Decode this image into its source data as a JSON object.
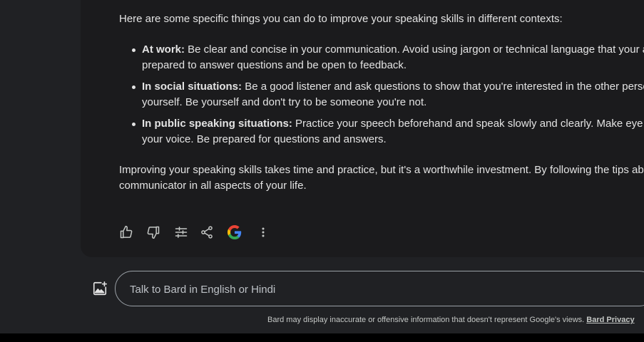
{
  "response": {
    "intro": "Here are some specific things you can do to improve your speaking skills in different contexts:",
    "bullets": [
      {
        "label": "At work:",
        "line1": " Be clear and concise in your communication. Avoid using jargon or technical language that your aud",
        "line2": "prepared to answer questions and be open to feedback."
      },
      {
        "label": "In social situations:",
        "line1": " Be a good listener and ask questions to show that you're interested in the other person.",
        "line2": "yourself. Be yourself and don't try to be someone you're not."
      },
      {
        "label": "In public speaking situations:",
        "line1": " Practice your speech beforehand and speak slowly and clearly. Make eye con",
        "line2": "your voice. Be prepared for questions and answers."
      }
    ],
    "outro_line1": "Improving your speaking skills takes time and practice, but it's a worthwhile investment. By following the tips abov",
    "outro_line2": "communicator in all aspects of your life."
  },
  "actions": [
    {
      "name": "thumbs-up-icon"
    },
    {
      "name": "thumbs-down-icon"
    },
    {
      "name": "modify-response-icon"
    },
    {
      "name": "share-icon"
    },
    {
      "name": "google-search-icon"
    },
    {
      "name": "more-options-icon"
    }
  ],
  "composer": {
    "placeholder": "Talk to Bard in English or Hindi",
    "add_image_icon": "add-image-icon"
  },
  "footer": {
    "disclaimer": "Bard may display inaccurate or offensive information that doesn't represent Google's views.",
    "privacy_link": "Bard Privacy"
  },
  "colors": {
    "background": "#202124",
    "card": "#1b1b1d",
    "text": "#e3e3e3",
    "google_blue": "#4285F4",
    "google_red": "#EA4335",
    "google_yellow": "#FBBC05",
    "google_green": "#34A853"
  }
}
